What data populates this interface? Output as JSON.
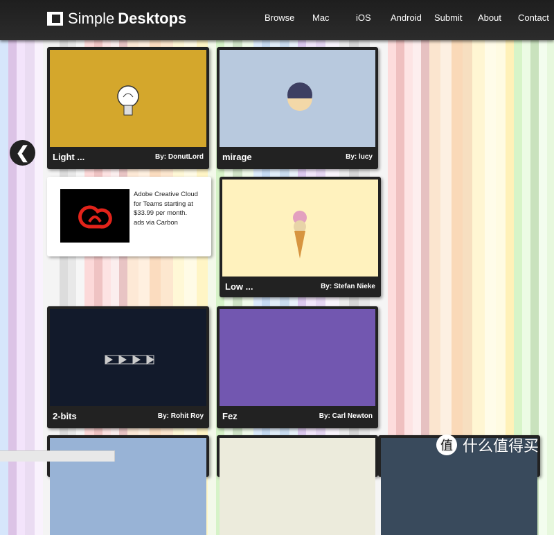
{
  "header": {
    "logo_light": "Simple",
    "logo_bold": "Desktops",
    "nav": [
      "Browse",
      "Mac",
      "iOS",
      "Android",
      "Submit",
      "About",
      "Contact"
    ]
  },
  "cards": [
    {
      "title": "Light ...",
      "author": "By: DonutLord",
      "bg": "#d4a72c"
    },
    {
      "title": "mirage",
      "author": "By: lucy",
      "bg": "#b8c9de"
    },
    {
      "title": "Low ...",
      "author": "By: Stefan Nieke",
      "bg": "#fff2be"
    },
    {
      "title": "2-bits",
      "author": "By: Rohit Roy",
      "bg": "#121a2b"
    },
    {
      "title": "Fez",
      "author": "By: Carl Newton",
      "bg": "#7257b0"
    }
  ],
  "ad": {
    "text": "Adobe Creative Cloud for Teams starting at $33.99 per month.",
    "via": "ads via Carbon"
  },
  "prev_icon": "chevron-left-icon",
  "watermark": {
    "badge": "值",
    "text": "什么值得买"
  }
}
